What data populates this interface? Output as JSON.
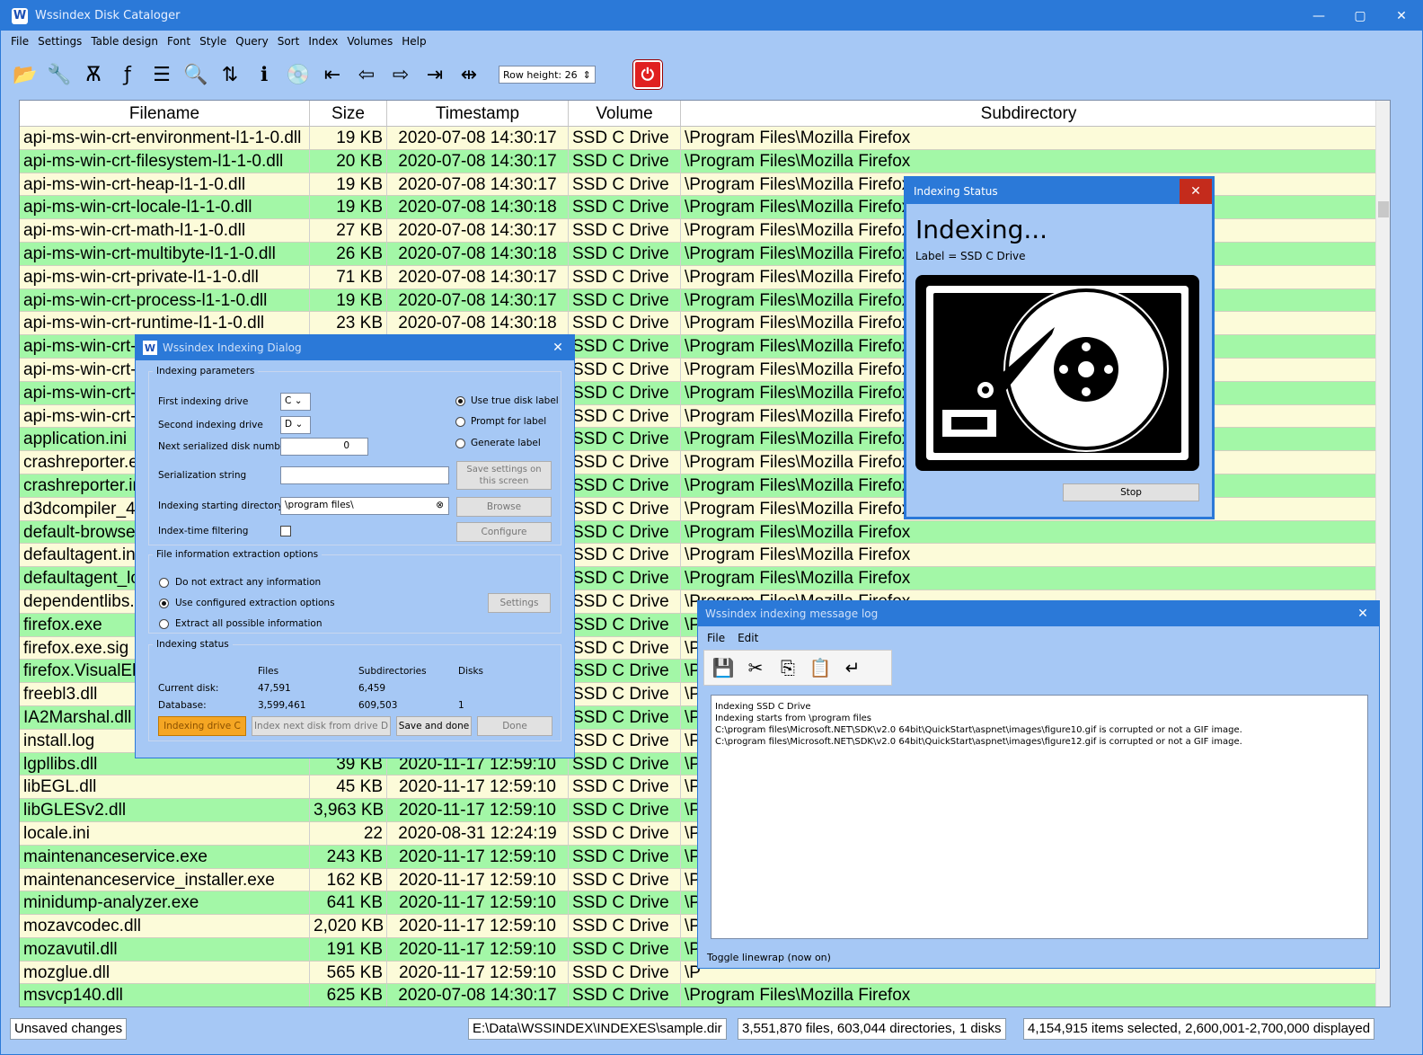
{
  "window": {
    "title": "Wssindex Disk Cataloger",
    "minimize": "—",
    "maximize": "▢",
    "close": "✕"
  },
  "menu": [
    "File",
    "Settings",
    "Table design",
    "Font",
    "Style",
    "Query",
    "Sort",
    "Index",
    "Volumes",
    "Help"
  ],
  "toolbar": {
    "row_height_label": "Row height: 26",
    "power": "⏻"
  },
  "grid": {
    "headers": [
      "Filename",
      "Size",
      "Timestamp",
      "Volume",
      "Subdirectory"
    ],
    "rows": [
      [
        "api-ms-win-crt-environment-l1-1-0.dll",
        "19 KB",
        "2020-07-08 14:30:17",
        "SSD C Drive",
        "\\Program Files\\Mozilla Firefox"
      ],
      [
        "api-ms-win-crt-filesystem-l1-1-0.dll",
        "20 KB",
        "2020-07-08 14:30:17",
        "SSD C Drive",
        "\\Program Files\\Mozilla Firefox"
      ],
      [
        "api-ms-win-crt-heap-l1-1-0.dll",
        "19 KB",
        "2020-07-08 14:30:17",
        "SSD C Drive",
        "\\Program Files\\Mozilla Firefox"
      ],
      [
        "api-ms-win-crt-locale-l1-1-0.dll",
        "19 KB",
        "2020-07-08 14:30:18",
        "SSD C Drive",
        "\\Program Files\\Mozilla Firefox"
      ],
      [
        "api-ms-win-crt-math-l1-1-0.dll",
        "27 KB",
        "2020-07-08 14:30:17",
        "SSD C Drive",
        "\\Program Files\\Mozilla Firefox"
      ],
      [
        "api-ms-win-crt-multibyte-l1-1-0.dll",
        "26 KB",
        "2020-07-08 14:30:18",
        "SSD C Drive",
        "\\Program Files\\Mozilla Firefox"
      ],
      [
        "api-ms-win-crt-private-l1-1-0.dll",
        "71 KB",
        "2020-07-08 14:30:17",
        "SSD C Drive",
        "\\Program Files\\Mozilla Firefox"
      ],
      [
        "api-ms-win-crt-process-l1-1-0.dll",
        "19 KB",
        "2020-07-08 14:30:17",
        "SSD C Drive",
        "\\Program Files\\Mozilla Firefox"
      ],
      [
        "api-ms-win-crt-runtime-l1-1-0.dll",
        "23 KB",
        "2020-07-08 14:30:18",
        "SSD C Drive",
        "\\Program Files\\Mozilla Firefox"
      ],
      [
        "api-ms-win-crt-s",
        "",
        "",
        "SSD C Drive",
        "\\Program Files\\Mozilla Firefox"
      ],
      [
        "api-ms-win-crt-s",
        "",
        "",
        "SSD C Drive",
        "\\Program Files\\Mozilla Firefox"
      ],
      [
        "api-ms-win-crt-t",
        "",
        "",
        "SSD C Drive",
        "\\Program Files\\Mozilla Firefox"
      ],
      [
        "api-ms-win-crt-u",
        "",
        "",
        "SSD C Drive",
        "\\Program Files\\Mozilla Firefox"
      ],
      [
        "application.ini",
        "",
        "",
        "SSD C Drive",
        "\\Program Files\\Mozilla Firefox"
      ],
      [
        "crashreporter.e",
        "",
        "",
        "SSD C Drive",
        "\\Program Files\\Mozilla Firefox"
      ],
      [
        "crashreporter.in",
        "",
        "",
        "SSD C Drive",
        "\\Program Files\\Mozilla Firefox"
      ],
      [
        "d3dcompiler_4",
        "",
        "",
        "SSD C Drive",
        "\\Program Files\\Mozilla Firefox"
      ],
      [
        "default-browse",
        "",
        "",
        "SSD C Drive",
        "\\Program Files\\Mozilla Firefox"
      ],
      [
        "defaultagent.ini",
        "",
        "",
        "SSD C Drive",
        "\\Program Files\\Mozilla Firefox"
      ],
      [
        "defaultagent_lo",
        "",
        "",
        "SSD C Drive",
        "\\Program Files\\Mozilla Firefox"
      ],
      [
        "dependentlibs.",
        "",
        "",
        "SSD C Drive",
        "\\Program Files\\Mozilla Firefox"
      ],
      [
        "firefox.exe",
        "",
        "",
        "SSD C Drive",
        "\\P"
      ],
      [
        "firefox.exe.sig",
        "",
        "",
        "SSD C Drive",
        "\\P"
      ],
      [
        "firefox.VisualEl",
        "",
        "",
        "SSD C Drive",
        "\\P"
      ],
      [
        "freebl3.dll",
        "",
        "",
        "SSD C Drive",
        "\\P"
      ],
      [
        "IA2Marshal.dll",
        "",
        "",
        "SSD C Drive",
        "\\P"
      ],
      [
        "install.log",
        "",
        "",
        "SSD C Drive",
        "\\P"
      ],
      [
        "lgpllibs.dll",
        "39 KB",
        "2020-11-17 12:59:10",
        "SSD C Drive",
        "\\P"
      ],
      [
        "libEGL.dll",
        "45 KB",
        "2020-11-17 12:59:10",
        "SSD C Drive",
        "\\P"
      ],
      [
        "libGLESv2.dll",
        "3,963 KB",
        "2020-11-17 12:59:10",
        "SSD C Drive",
        "\\P"
      ],
      [
        "locale.ini",
        "22",
        "2020-08-31 12:24:19",
        "SSD C Drive",
        "\\P"
      ],
      [
        "maintenanceservice.exe",
        "243 KB",
        "2020-11-17 12:59:10",
        "SSD C Drive",
        "\\P"
      ],
      [
        "maintenanceservice_installer.exe",
        "162 KB",
        "2020-11-17 12:59:10",
        "SSD C Drive",
        "\\P"
      ],
      [
        "minidump-analyzer.exe",
        "641 KB",
        "2020-11-17 12:59:10",
        "SSD C Drive",
        "\\P"
      ],
      [
        "mozavcodec.dll",
        "2,020 KB",
        "2020-11-17 12:59:10",
        "SSD C Drive",
        "\\P"
      ],
      [
        "mozavutil.dll",
        "191 KB",
        "2020-11-17 12:59:10",
        "SSD C Drive",
        "\\P"
      ],
      [
        "mozglue.dll",
        "565 KB",
        "2020-11-17 12:59:10",
        "SSD C Drive",
        "\\P"
      ],
      [
        "msvcp140.dll",
        "625 KB",
        "2020-07-08 14:30:17",
        "SSD C Drive",
        "\\Program Files\\Mozilla Firefox"
      ]
    ]
  },
  "statusbar": {
    "unsaved": "Unsaved changes",
    "path": "E:\\Data\\WSSINDEX\\INDEXES\\sample.dir",
    "counts": "3,551,870 files, 603,044 directories, 1 disks",
    "selection": "4,154,915 items selected, 2,600,001-2,700,000 displayed"
  },
  "indexing_dialog": {
    "title": "Wssindex Indexing Dialog",
    "params_legend": "Indexing parameters",
    "first_drive_label": "First indexing drive",
    "first_drive": "C",
    "second_drive_label": "Second indexing drive",
    "second_drive": "D",
    "next_serial_label": "Next serialized disk number",
    "next_serial": "0",
    "radio_true_label": "Use true disk label",
    "radio_prompt": "Prompt for label",
    "radio_generate": "Generate label",
    "serial_string_label": "Serialization string",
    "serial_string": "",
    "save_settings": "Save settings on this screen",
    "start_dir_label": "Indexing starting directory",
    "start_dir": "\\program files\\",
    "browse": "Browse",
    "filter_label": "Index-time filtering",
    "configure": "Configure",
    "extract_legend": "File information extraction options",
    "extract_none": "Do not extract any information",
    "extract_configured": "Use configured extraction options",
    "extract_all": "Extract all possible information",
    "settings": "Settings",
    "status_legend": "Indexing status",
    "col_files": "Files",
    "col_subdirs": "Subdirectories",
    "col_disks": "Disks",
    "current_label": "Current disk:",
    "current_files": "47,591",
    "current_subdirs": "6,459",
    "db_label": "Database:",
    "db_files": "3,599,461",
    "db_subdirs": "609,503",
    "db_disks": "1",
    "btn_indexing": "Indexing drive C",
    "btn_next": "Index next disk from drive D",
    "btn_save": "Save and done",
    "btn_done": "Done"
  },
  "status_dialog": {
    "title": "Indexing Status",
    "heading": "Indexing...",
    "label": "Label = SSD C Drive",
    "stop": "Stop"
  },
  "log_dialog": {
    "title": "Wssindex indexing message log",
    "menu_file": "File",
    "menu_edit": "Edit",
    "log": "Indexing SSD C Drive\nIndexing starts from \\program files\nC:\\program files\\Microsoft.NET\\SDK\\v2.0 64bit\\QuickStart\\aspnet\\images\\figure10.gif is corrupted or not a GIF image.\nC:\\program files\\Microsoft.NET\\SDK\\v2.0 64bit\\QuickStart\\aspnet\\images\\figure12.gif is corrupted or not a GIF image.",
    "toggle": "Toggle linewrap (now on)"
  }
}
